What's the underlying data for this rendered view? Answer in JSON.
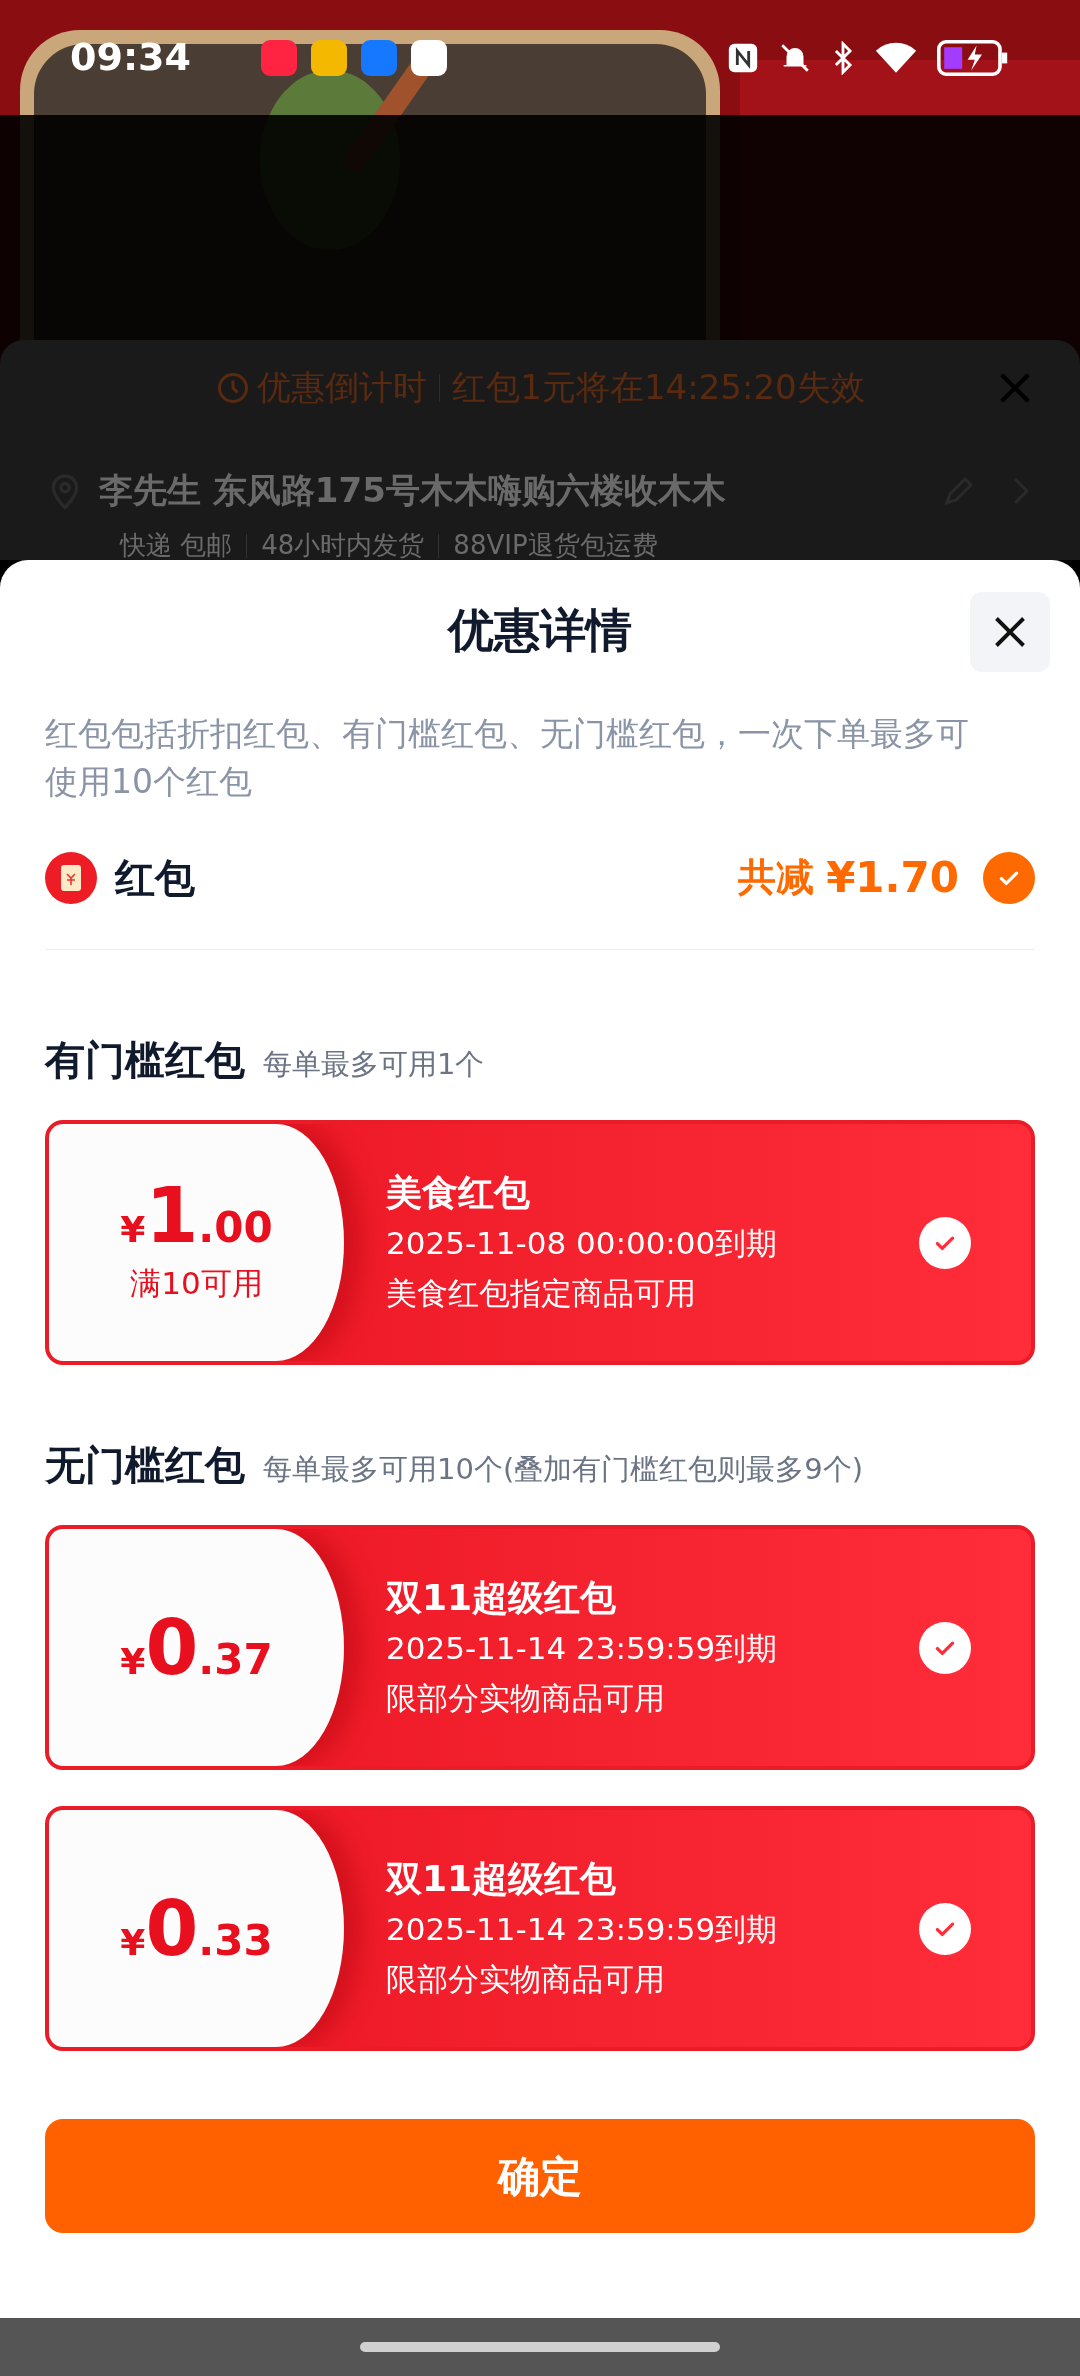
{
  "status_bar": {
    "time": "09:34"
  },
  "background_panel": {
    "countdown_label": "优惠倒计时",
    "countdown_text": "红包1元将在14:25:20失效",
    "address": "李先生 东风路175号木木嗨购六楼收木木",
    "service_tags": [
      "快递 包邮",
      "48小时内发货",
      "88VIP退货包运费"
    ]
  },
  "sheet": {
    "title": "优惠详情",
    "description": "红包包括折扣红包、有门槛红包、无门槛红包，一次下单最多可使用10个红包",
    "summary": {
      "label": "红包",
      "total_label": "共减",
      "total": "¥1.70",
      "checked": true
    },
    "sections": [
      {
        "title": "有门槛红包",
        "note": "每单最多可用1个",
        "coupons": [
          {
            "currency": "¥",
            "amount_integer": "1",
            "amount_decimal": ".00",
            "condition": "满10可用",
            "name": "美食红包",
            "expiry": "2025-11-08 00:00:00到期",
            "scope": "美食红包指定商品可用",
            "selected": true
          }
        ]
      },
      {
        "title": "无门槛红包",
        "note": "每单最多可用10个(叠加有门槛红包则最多9个)",
        "coupons": [
          {
            "currency": "¥",
            "amount_integer": "0",
            "amount_decimal": ".37",
            "name": "双11超级红包",
            "expiry": "2025-11-14 23:59:59到期",
            "scope": "限部分实物商品可用",
            "selected": true
          },
          {
            "currency": "¥",
            "amount_integer": "0",
            "amount_decimal": ".33",
            "name": "双11超级红包",
            "expiry": "2025-11-14 23:59:59到期",
            "scope": "限部分实物商品可用",
            "selected": true
          }
        ]
      }
    ],
    "confirm_button": "确定"
  }
}
